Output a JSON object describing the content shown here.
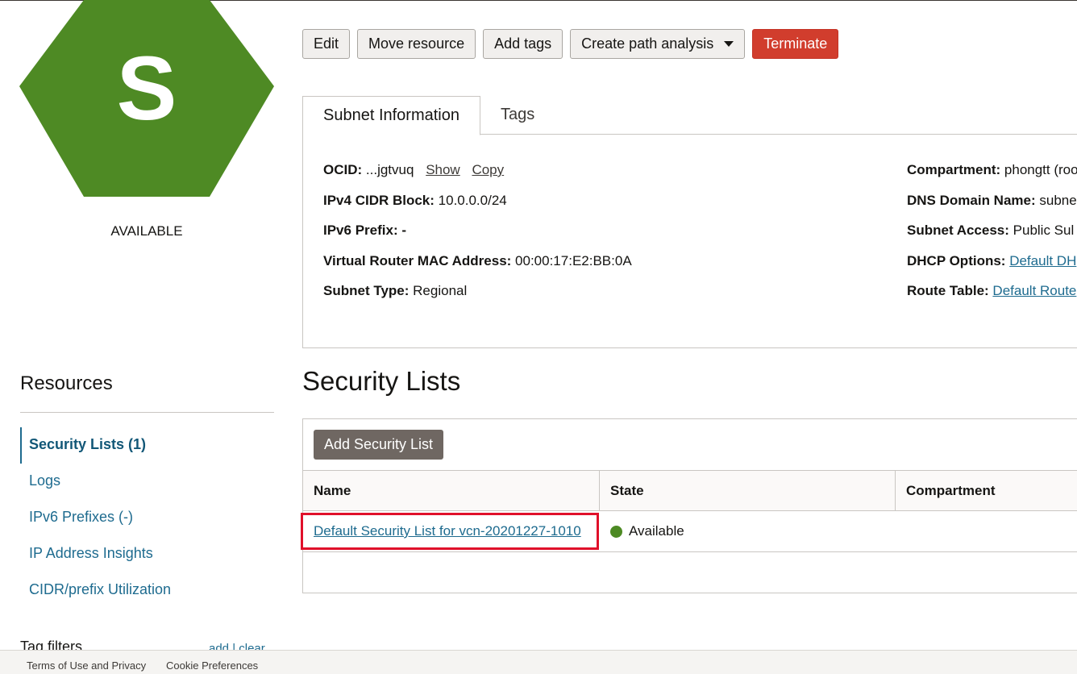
{
  "resource": {
    "icon_letter": "S",
    "icon_color": "#4e8a24",
    "status": "AVAILABLE"
  },
  "actions": {
    "edit": "Edit",
    "move": "Move resource",
    "add_tags": "Add tags",
    "path_analysis": "Create path analysis",
    "terminate": "Terminate"
  },
  "tabs": {
    "subnet_info": "Subnet Information",
    "tags": "Tags"
  },
  "info": {
    "ocid_label": "OCID:",
    "ocid_value": "...jgtvuq",
    "show": "Show",
    "copy": "Copy",
    "ipv4_label": "IPv4 CIDR Block:",
    "ipv4_value": "10.0.0.0/24",
    "ipv6_label": "IPv6 Prefix:",
    "ipv6_value": "-",
    "mac_label": "Virtual Router MAC Address:",
    "mac_value": "00:00:17:E2:BB:0A",
    "subnet_type_label": "Subnet Type:",
    "subnet_type_value": "Regional",
    "compartment_label": "Compartment:",
    "compartment_value": "phongtt (roo",
    "dns_label": "DNS Domain Name:",
    "dns_value": "subne",
    "access_label": "Subnet Access:",
    "access_value": "Public Sul",
    "dhcp_label": "DHCP Options:",
    "dhcp_value": "Default DH",
    "route_label": "Route Table:",
    "route_value": "Default Route"
  },
  "resources": {
    "title": "Resources",
    "items": [
      "Security Lists (1)",
      "Logs",
      "IPv6 Prefixes (-)",
      "IP Address Insights",
      "CIDR/prefix Utilization"
    ],
    "tag_filters": "Tag filters",
    "tag_filters_actions": "add | clear"
  },
  "security_lists": {
    "title": "Security Lists",
    "add_button": "Add Security List",
    "columns": [
      "Name",
      "State",
      "Compartment"
    ],
    "rows": [
      {
        "name": "Default Security List for vcn-20201227-1010",
        "state": "Available",
        "compartment": ""
      }
    ]
  },
  "footer": {
    "terms": "Terms of Use and Privacy",
    "cookies": "Cookie Preferences"
  }
}
